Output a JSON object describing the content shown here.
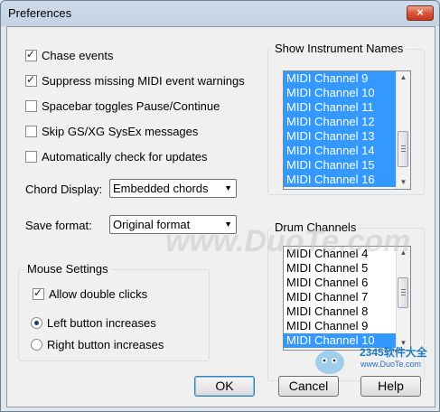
{
  "window": {
    "title": "Preferences",
    "close_label": "×"
  },
  "options": [
    {
      "label": "Chase events",
      "checked": true
    },
    {
      "label": "Suppress missing MIDI event warnings",
      "checked": true
    },
    {
      "label": "Spacebar toggles Pause/Continue",
      "checked": false
    },
    {
      "label": "Skip GS/XG SysEx messages",
      "checked": false
    },
    {
      "label": "Automatically check for updates",
      "checked": false
    }
  ],
  "chord_display": {
    "label": "Chord Display:",
    "value": "Embedded chords"
  },
  "save_format": {
    "label": "Save format:",
    "value": "Original format"
  },
  "mouse_settings": {
    "title": "Mouse Settings",
    "allow_double_clicks": {
      "label": "Allow double clicks",
      "checked": true
    },
    "left_increases": {
      "label": "Left button increases",
      "selected": true
    },
    "right_increases": {
      "label": "Right button increases",
      "selected": false
    }
  },
  "instrument_names": {
    "title": "Show Instrument Names",
    "items": [
      "MIDI Channel  9",
      "MIDI Channel 10",
      "MIDI Channel 11",
      "MIDI Channel 12",
      "MIDI Channel 13",
      "MIDI Channel 14",
      "MIDI Channel 15",
      "MIDI Channel 16"
    ],
    "selected": [
      true,
      true,
      true,
      true,
      true,
      true,
      true,
      true
    ]
  },
  "drum_channels": {
    "title": "Drum Channels",
    "items": [
      "MIDI Channel  4",
      "MIDI Channel  5",
      "MIDI Channel  6",
      "MIDI Channel  7",
      "MIDI Channel  8",
      "MIDI Channel  9",
      "MIDI Channel 10"
    ],
    "selected": [
      false,
      false,
      false,
      false,
      false,
      false,
      true
    ]
  },
  "buttons": {
    "ok": "OK",
    "cancel": "Cancel",
    "help": "Help"
  },
  "watermark": "www.DuoTe.com",
  "logo": {
    "text": "2345软件大全",
    "url": "www.DuoTe.com"
  },
  "colors": {
    "selection": "#3399ff",
    "window_bg": "#f0f0f0"
  }
}
